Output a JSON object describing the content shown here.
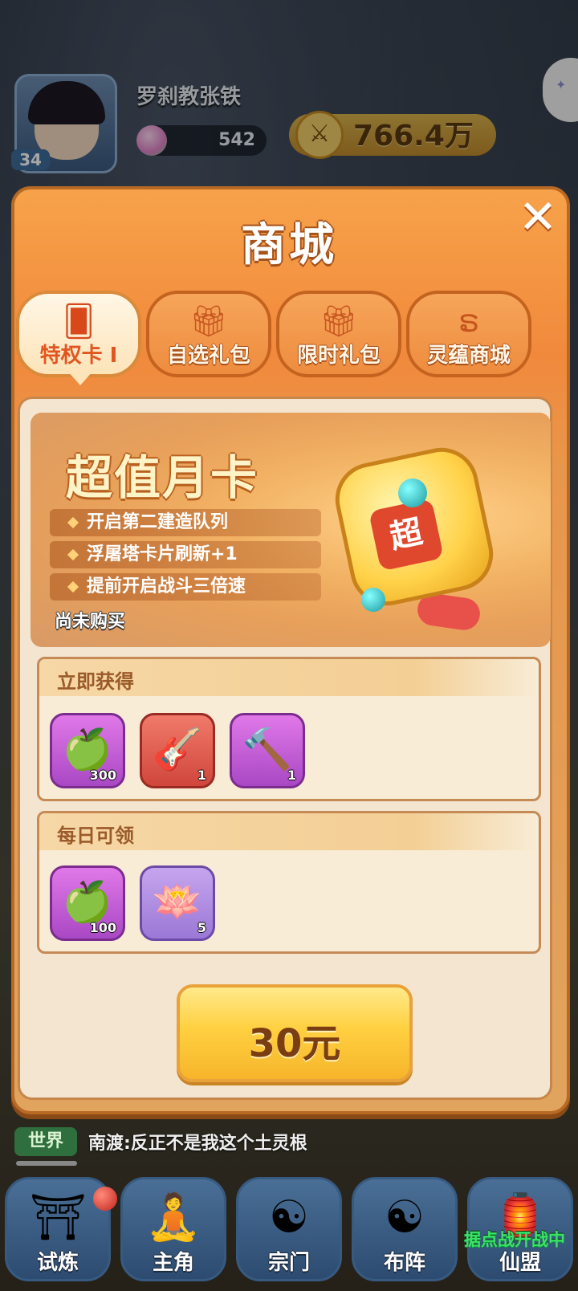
{
  "player": {
    "name": "罗刹教张铁",
    "level": "34",
    "resource_value": "542",
    "power": "766.4万"
  },
  "shop": {
    "title": "商城",
    "tabs": [
      {
        "label": "特权卡 I",
        "icon": "cards-icon",
        "active": true
      },
      {
        "label": "自选礼包",
        "icon": "gift-icon",
        "active": false
      },
      {
        "label": "限时礼包",
        "icon": "gift-icon",
        "active": false
      },
      {
        "label": "灵蕴商城",
        "icon": "dragon-icon",
        "active": false
      }
    ],
    "card": {
      "title": "超值月卡",
      "emblem_char": "超",
      "perks": [
        "开启第二建造队列",
        "浮屠塔卡片刷新+1",
        "提前开启战斗三倍速"
      ],
      "status": "尚未购买"
    },
    "instant": {
      "title": "立即获得",
      "items": [
        {
          "icon": "spirit-fruit-icon",
          "count": "300"
        },
        {
          "icon": "pipa-icon",
          "count": "1"
        },
        {
          "icon": "hammer-icon",
          "count": "1"
        }
      ]
    },
    "daily": {
      "title": "每日可领",
      "items": [
        {
          "icon": "spirit-fruit-icon",
          "count": "100"
        },
        {
          "icon": "lotus-icon",
          "count": "5"
        }
      ]
    },
    "price_label": "30元"
  },
  "chat": {
    "channel": "世界",
    "message": "南渡:反正不是我这个土灵根"
  },
  "nav": {
    "items": [
      "试炼",
      "主角",
      "宗门",
      "布阵",
      "仙盟"
    ],
    "alert": "据点战开战中"
  },
  "colors": {
    "modal_orange": "#f1893c",
    "button_gold": "#ffd041",
    "tab_active_text": "#e2551f"
  }
}
